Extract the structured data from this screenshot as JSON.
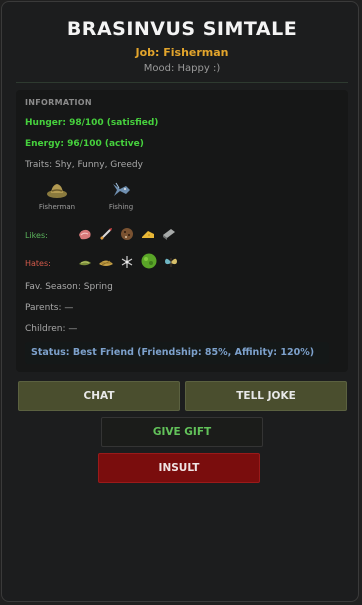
{
  "npc": {
    "name": "BRASINVUS SIMTALE",
    "job": "Job: Fisherman",
    "mood": "Mood: Happy :)"
  },
  "info": {
    "section_title": "INFORMATION",
    "hunger": "Hunger: 98/100 (satisfied)",
    "energy": "Energy: 96/100 (active)",
    "traits": "Traits: Shy, Funny, Greedy",
    "skills": [
      {
        "label": "Fisherman",
        "icon": "hat-icon"
      },
      {
        "label": "Fishing",
        "icon": "fish-icon"
      }
    ],
    "likes_label": "Likes:",
    "likes": [
      "meat-item-icon",
      "rocket-item-icon",
      "cookie-item-icon",
      "cheese-item-icon",
      "metal-bar-item-icon"
    ],
    "hates_label": "Hates:",
    "hates": [
      "seaweed-item-icon",
      "hay-item-icon",
      "crystal-item-icon",
      "bush-item-icon",
      "butterfly-item-icon"
    ],
    "fav_season": "Fav. Season: Spring",
    "parents": "Parents: —",
    "children": "Children: —",
    "status": "Status: Best Friend (Friendship: 85%, Affinity: 120%)"
  },
  "actions": {
    "chat": "CHAT",
    "tell_joke": "TELL JOKE",
    "give_gift": "GIVE GIFT",
    "insult": "INSULT"
  },
  "colors": {
    "job": "#e3a52c",
    "stat_green": "#46d13d",
    "status_blue": "#7da1cc",
    "insult_red": "#7a0d0d"
  }
}
